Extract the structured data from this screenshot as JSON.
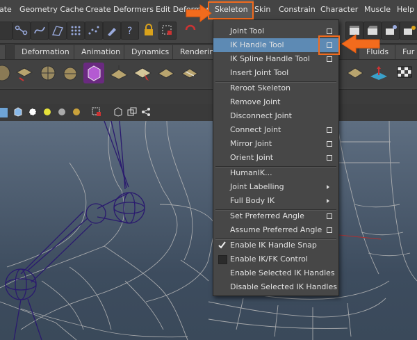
{
  "menubar": [
    {
      "id": "create",
      "label": "ate"
    },
    {
      "id": "geometry-cache",
      "label": "Geometry Cache"
    },
    {
      "id": "create-deformers",
      "label": "Create Deformers"
    },
    {
      "id": "edit-deformers",
      "label": "Edit Deformers"
    },
    {
      "id": "skeleton",
      "label": "Skeleton"
    },
    {
      "id": "skin",
      "label": "Skin"
    },
    {
      "id": "constrain",
      "label": "Constrain"
    },
    {
      "id": "character",
      "label": "Character"
    },
    {
      "id": "muscle",
      "label": "Muscle"
    },
    {
      "id": "help",
      "label": "Help"
    }
  ],
  "tabs": [
    {
      "id": "deformation",
      "label": "Deformation"
    },
    {
      "id": "animation",
      "label": "Animation"
    },
    {
      "id": "dynamics",
      "label": "Dynamics"
    },
    {
      "id": "rendering",
      "label": "Rendering"
    },
    {
      "id": "fluids",
      "label": "Fluids"
    },
    {
      "id": "fur",
      "label": "Fur"
    }
  ],
  "skeleton_menu": {
    "items": [
      {
        "label": "Joint Tool",
        "option_box": true
      },
      {
        "label": "IK Handle Tool",
        "option_box": true,
        "highlighted": true
      },
      {
        "label": "IK Spline Handle Tool",
        "option_box": true
      },
      {
        "label": "Insert Joint Tool"
      },
      {
        "label": "Reroot Skeleton"
      },
      {
        "label": "Remove Joint"
      },
      {
        "label": "Disconnect Joint"
      },
      {
        "label": "Connect Joint",
        "option_box": true
      },
      {
        "label": "Mirror Joint",
        "option_box": true
      },
      {
        "label": "Orient Joint",
        "option_box": true
      },
      {
        "label": "HumanIK..."
      },
      {
        "label": "Joint Labelling",
        "submenu": true
      },
      {
        "label": "Full Body IK",
        "submenu": true
      },
      {
        "label": "Set Preferred Angle",
        "option_box": true
      },
      {
        "label": "Assume Preferred Angle",
        "option_box": true
      },
      {
        "label": "Enable IK Handle Snap",
        "checked": true
      },
      {
        "label": "Enable IK/FK Control",
        "checked": false
      },
      {
        "label": "Enable Selected IK Handles"
      },
      {
        "label": "Disable Selected IK Handles"
      }
    ]
  },
  "colors": {
    "callout": "#f26b1d",
    "menu_highlight": "#5d8ab4",
    "menu_bg": "#474747",
    "joint_lines": "#2a1a6e"
  },
  "icons": {
    "check": "check-icon",
    "option_box": "option-box-icon",
    "submenu": "submenu-arrow-icon"
  }
}
